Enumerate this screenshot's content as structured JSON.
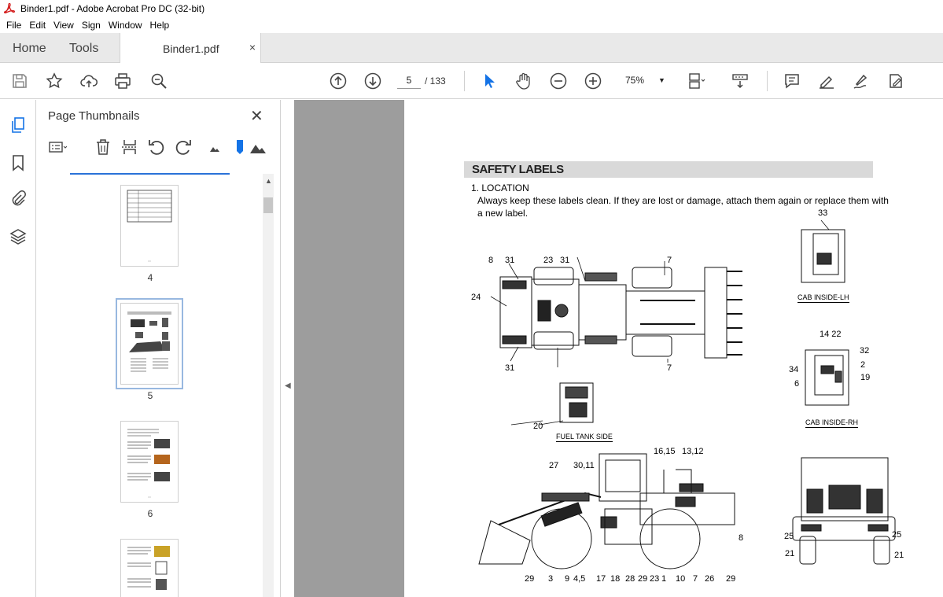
{
  "window": {
    "title": "Binder1.pdf - Adobe Acrobat Pro DC (32-bit)"
  },
  "menu": [
    "File",
    "Edit",
    "View",
    "Sign",
    "Window",
    "Help"
  ],
  "tabs": {
    "home": "Home",
    "tools": "Tools",
    "document": "Binder1.pdf",
    "close": "×"
  },
  "toolbar": {
    "page_current": "5",
    "page_total": "/ 133",
    "zoom": "75%"
  },
  "panel": {
    "title": "Page Thumbnails",
    "close": "✕",
    "thumbnails": [
      {
        "label": "4"
      },
      {
        "label": "5"
      },
      {
        "label": "6"
      },
      {
        "label": ""
      }
    ]
  },
  "document_page": {
    "heading": "SAFETY LABELS",
    "section": "1. LOCATION",
    "para_line1": "Always keep these labels clean.  If they are lost or damage, attach them again or replace them with",
    "para_line2": "a new label.",
    "captions": {
      "cab_lh": "CAB INSIDE-LH",
      "cab_rh": "CAB INSIDE-RH",
      "fuel": "FUEL TANK SIDE"
    },
    "callouts": {
      "top_view": [
        "8",
        "31",
        "23",
        "31",
        "7",
        "24",
        "31",
        "7"
      ],
      "cab_lh": [
        "33"
      ],
      "cab_rh": [
        "14 22",
        "32",
        "2",
        "34",
        "6",
        "19"
      ],
      "fuel": [
        "20"
      ],
      "side_top": [
        "16,15",
        "13,12",
        "27",
        "30,11",
        "8"
      ],
      "side_bottom": [
        "29",
        "3",
        "9",
        "4,5",
        "17",
        "18",
        "28",
        "29",
        "23",
        "1",
        "10",
        "7",
        "26",
        "29"
      ],
      "rear": [
        "25",
        "25",
        "21",
        "21"
      ]
    }
  },
  "colors": {
    "accent": "#2a72d8",
    "cursor_blue": "#1473e6",
    "viewer_bg": "#9d9d9d"
  }
}
